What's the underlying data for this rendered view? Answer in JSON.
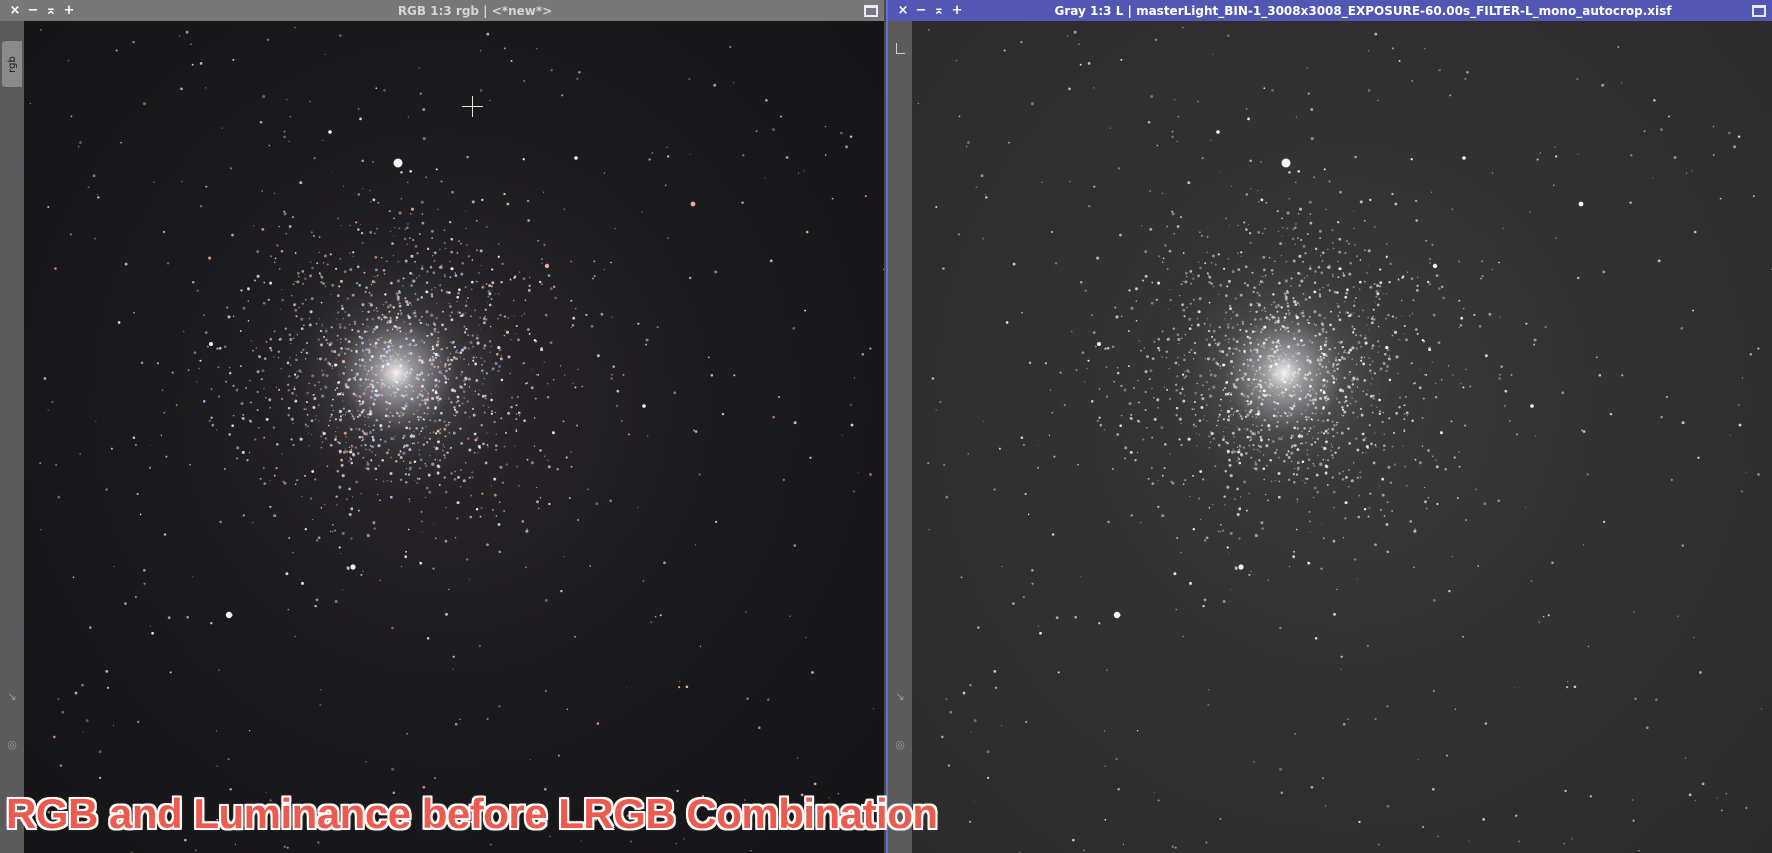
{
  "left_window": {
    "title": "RGB 1:3 rgb | <*new*>",
    "controls": {
      "close": "×",
      "minimize": "−",
      "shade": "⌅",
      "expand": "+"
    },
    "side_tab": "rgb",
    "image_tint": "color",
    "background_color": "#1b1a1d"
  },
  "right_window": {
    "title": "Gray 1:3 L | masterLight_BIN-1_3008x3008_EXPOSURE-60.00s_FILTER-L_mono_autocrop.xisf",
    "controls": {
      "close": "×",
      "minimize": "−",
      "shade": "⌅",
      "expand": "+"
    },
    "image_tint": "gray",
    "background_color": "#303030"
  },
  "caption": "RGB and Luminance before LRGB Combination",
  "colors": {
    "active_title": "#5257b3",
    "inactive_title": "#787878",
    "caption_red": "#ee5a4e"
  }
}
